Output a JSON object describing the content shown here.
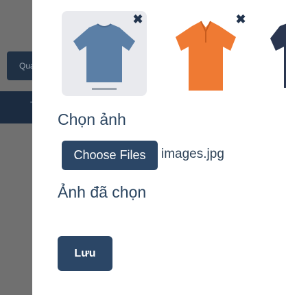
{
  "background": {
    "button_label": "Qua",
    "bar_label": "T"
  },
  "images": [
    {
      "icon": "tshirt-blue-image",
      "color": "#5b7fa6",
      "remove_icon": "close-icon",
      "remove_glyph": "✖"
    },
    {
      "icon": "polo-orange-image",
      "color": "#ef7a33",
      "remove_icon": "close-icon",
      "remove_glyph": "✖"
    },
    {
      "icon": "polo-navy-image",
      "color": "#2a3650"
    }
  ],
  "upload": {
    "title": "Chọn ảnh",
    "button_label": "Choose Files",
    "file_name": "images.jpg"
  },
  "selected": {
    "title": "Ảnh đã chọn"
  },
  "save_label": "Lưu",
  "colors": {
    "primary": "#2b4666",
    "heading": "#2b4560",
    "overlay": "#5f5f5f"
  }
}
